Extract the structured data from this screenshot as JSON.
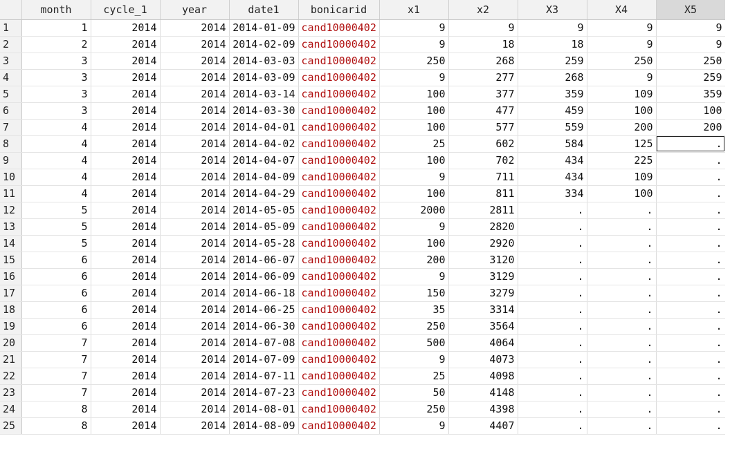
{
  "columns": [
    "month",
    "cycle_1",
    "year",
    "date1",
    "bonicarid",
    "x1",
    "x2",
    "X3",
    "X4",
    "X5"
  ],
  "selected_column": "X5",
  "active_cell": {
    "row": 8,
    "column": "X5"
  },
  "rows": [
    {
      "n": "1",
      "month": "1",
      "cycle_1": "2014",
      "year": "2014",
      "date1": "2014-01-09",
      "bonicarid": "cand10000402",
      "x1": "9",
      "x2": "9",
      "X3": "9",
      "X4": "9",
      "X5": "9"
    },
    {
      "n": "2",
      "month": "2",
      "cycle_1": "2014",
      "year": "2014",
      "date1": "2014-02-09",
      "bonicarid": "cand10000402",
      "x1": "9",
      "x2": "18",
      "X3": "18",
      "X4": "9",
      "X5": "9"
    },
    {
      "n": "3",
      "month": "3",
      "cycle_1": "2014",
      "year": "2014",
      "date1": "2014-03-03",
      "bonicarid": "cand10000402",
      "x1": "250",
      "x2": "268",
      "X3": "259",
      "X4": "250",
      "X5": "250"
    },
    {
      "n": "4",
      "month": "3",
      "cycle_1": "2014",
      "year": "2014",
      "date1": "2014-03-09",
      "bonicarid": "cand10000402",
      "x1": "9",
      "x2": "277",
      "X3": "268",
      "X4": "9",
      "X5": "259"
    },
    {
      "n": "5",
      "month": "3",
      "cycle_1": "2014",
      "year": "2014",
      "date1": "2014-03-14",
      "bonicarid": "cand10000402",
      "x1": "100",
      "x2": "377",
      "X3": "359",
      "X4": "109",
      "X5": "359"
    },
    {
      "n": "6",
      "month": "3",
      "cycle_1": "2014",
      "year": "2014",
      "date1": "2014-03-30",
      "bonicarid": "cand10000402",
      "x1": "100",
      "x2": "477",
      "X3": "459",
      "X4": "100",
      "X5": "100"
    },
    {
      "n": "7",
      "month": "4",
      "cycle_1": "2014",
      "year": "2014",
      "date1": "2014-04-01",
      "bonicarid": "cand10000402",
      "x1": "100",
      "x2": "577",
      "X3": "559",
      "X4": "200",
      "X5": "200"
    },
    {
      "n": "8",
      "month": "4",
      "cycle_1": "2014",
      "year": "2014",
      "date1": "2014-04-02",
      "bonicarid": "cand10000402",
      "x1": "25",
      "x2": "602",
      "X3": "584",
      "X4": "125",
      "X5": "."
    },
    {
      "n": "9",
      "month": "4",
      "cycle_1": "2014",
      "year": "2014",
      "date1": "2014-04-07",
      "bonicarid": "cand10000402",
      "x1": "100",
      "x2": "702",
      "X3": "434",
      "X4": "225",
      "X5": "."
    },
    {
      "n": "10",
      "month": "4",
      "cycle_1": "2014",
      "year": "2014",
      "date1": "2014-04-09",
      "bonicarid": "cand10000402",
      "x1": "9",
      "x2": "711",
      "X3": "434",
      "X4": "109",
      "X5": "."
    },
    {
      "n": "11",
      "month": "4",
      "cycle_1": "2014",
      "year": "2014",
      "date1": "2014-04-29",
      "bonicarid": "cand10000402",
      "x1": "100",
      "x2": "811",
      "X3": "334",
      "X4": "100",
      "X5": "."
    },
    {
      "n": "12",
      "month": "5",
      "cycle_1": "2014",
      "year": "2014",
      "date1": "2014-05-05",
      "bonicarid": "cand10000402",
      "x1": "2000",
      "x2": "2811",
      "X3": ".",
      "X4": ".",
      "X5": "."
    },
    {
      "n": "13",
      "month": "5",
      "cycle_1": "2014",
      "year": "2014",
      "date1": "2014-05-09",
      "bonicarid": "cand10000402",
      "x1": "9",
      "x2": "2820",
      "X3": ".",
      "X4": ".",
      "X5": "."
    },
    {
      "n": "14",
      "month": "5",
      "cycle_1": "2014",
      "year": "2014",
      "date1": "2014-05-28",
      "bonicarid": "cand10000402",
      "x1": "100",
      "x2": "2920",
      "X3": ".",
      "X4": ".",
      "X5": "."
    },
    {
      "n": "15",
      "month": "6",
      "cycle_1": "2014",
      "year": "2014",
      "date1": "2014-06-07",
      "bonicarid": "cand10000402",
      "x1": "200",
      "x2": "3120",
      "X3": ".",
      "X4": ".",
      "X5": "."
    },
    {
      "n": "16",
      "month": "6",
      "cycle_1": "2014",
      "year": "2014",
      "date1": "2014-06-09",
      "bonicarid": "cand10000402",
      "x1": "9",
      "x2": "3129",
      "X3": ".",
      "X4": ".",
      "X5": "."
    },
    {
      "n": "17",
      "month": "6",
      "cycle_1": "2014",
      "year": "2014",
      "date1": "2014-06-18",
      "bonicarid": "cand10000402",
      "x1": "150",
      "x2": "3279",
      "X3": ".",
      "X4": ".",
      "X5": "."
    },
    {
      "n": "18",
      "month": "6",
      "cycle_1": "2014",
      "year": "2014",
      "date1": "2014-06-25",
      "bonicarid": "cand10000402",
      "x1": "35",
      "x2": "3314",
      "X3": ".",
      "X4": ".",
      "X5": "."
    },
    {
      "n": "19",
      "month": "6",
      "cycle_1": "2014",
      "year": "2014",
      "date1": "2014-06-30",
      "bonicarid": "cand10000402",
      "x1": "250",
      "x2": "3564",
      "X3": ".",
      "X4": ".",
      "X5": "."
    },
    {
      "n": "20",
      "month": "7",
      "cycle_1": "2014",
      "year": "2014",
      "date1": "2014-07-08",
      "bonicarid": "cand10000402",
      "x1": "500",
      "x2": "4064",
      "X3": ".",
      "X4": ".",
      "X5": "."
    },
    {
      "n": "21",
      "month": "7",
      "cycle_1": "2014",
      "year": "2014",
      "date1": "2014-07-09",
      "bonicarid": "cand10000402",
      "x1": "9",
      "x2": "4073",
      "X3": ".",
      "X4": ".",
      "X5": "."
    },
    {
      "n": "22",
      "month": "7",
      "cycle_1": "2014",
      "year": "2014",
      "date1": "2014-07-11",
      "bonicarid": "cand10000402",
      "x1": "25",
      "x2": "4098",
      "X3": ".",
      "X4": ".",
      "X5": "."
    },
    {
      "n": "23",
      "month": "7",
      "cycle_1": "2014",
      "year": "2014",
      "date1": "2014-07-23",
      "bonicarid": "cand10000402",
      "x1": "50",
      "x2": "4148",
      "X3": ".",
      "X4": ".",
      "X5": "."
    },
    {
      "n": "24",
      "month": "8",
      "cycle_1": "2014",
      "year": "2014",
      "date1": "2014-08-01",
      "bonicarid": "cand10000402",
      "x1": "250",
      "x2": "4398",
      "X3": ".",
      "X4": ".",
      "X5": "."
    },
    {
      "n": "25",
      "month": "8",
      "cycle_1": "2014",
      "year": "2014",
      "date1": "2014-08-09",
      "bonicarid": "cand10000402",
      "x1": "9",
      "x2": "4407",
      "X3": ".",
      "X4": ".",
      "X5": "."
    }
  ],
  "colors": {
    "string_text": "#b01010",
    "header_bg": "#f2f2f2",
    "selected_header_bg": "#d9d9d9"
  }
}
